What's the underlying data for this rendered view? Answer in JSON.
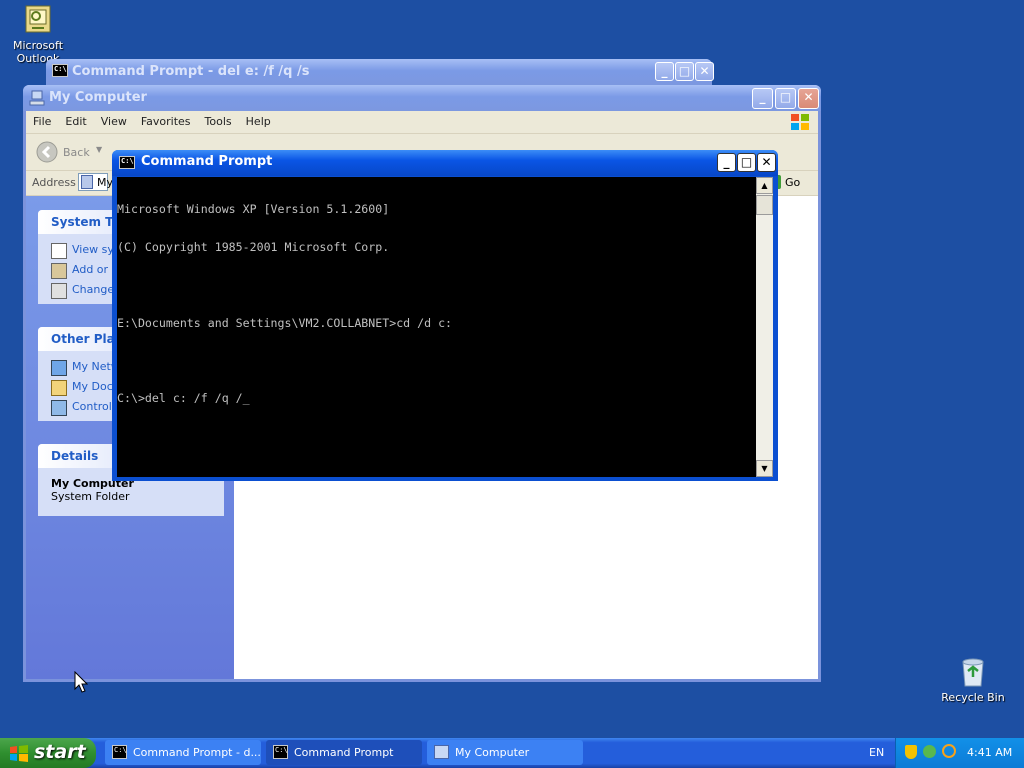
{
  "desktop": {
    "icons": [
      {
        "label": "Microsoft Outlook"
      },
      {
        "label": "Recycle Bin"
      }
    ]
  },
  "bg_window": {
    "title": "Command Prompt - del e: /f /q /s"
  },
  "explorer": {
    "title": "My Computer",
    "menu": [
      "File",
      "Edit",
      "View",
      "Favorites",
      "Tools",
      "Help"
    ],
    "back_label": "Back",
    "address_label": "Address",
    "address_value": "My",
    "go_label": "Go",
    "panels": {
      "system_tasks": {
        "header": "System Ta",
        "items": [
          "View sy",
          "Add or",
          "Change"
        ]
      },
      "other_places": {
        "header": "Other Plac",
        "items": [
          "My Netw",
          "My Doc",
          "Control"
        ]
      },
      "details": {
        "header": "Details",
        "name": "My Computer",
        "type": "System Folder"
      }
    }
  },
  "cmd_window": {
    "title": "Command Prompt",
    "lines": [
      "Microsoft Windows XP [Version 5.1.2600]",
      "(C) Copyright 1985-2001 Microsoft Corp.",
      "",
      "E:\\Documents and Settings\\VM2.COLLABNET>cd /d c:",
      "",
      "C:\\>del c: /f /q /_"
    ]
  },
  "taskbar": {
    "start_label": "start",
    "tasks": [
      {
        "label": "Command Prompt - d..."
      },
      {
        "label": "Command Prompt"
      },
      {
        "label": "My Computer"
      }
    ],
    "language": "EN",
    "clock": "4:41 AM"
  },
  "colors": {
    "desktop_bg": "#1d4fa3",
    "title_active": "#0a55e5",
    "title_inactive": "#7b9ae6",
    "console_bg": "#000000",
    "console_fg": "#c0c0c0"
  }
}
